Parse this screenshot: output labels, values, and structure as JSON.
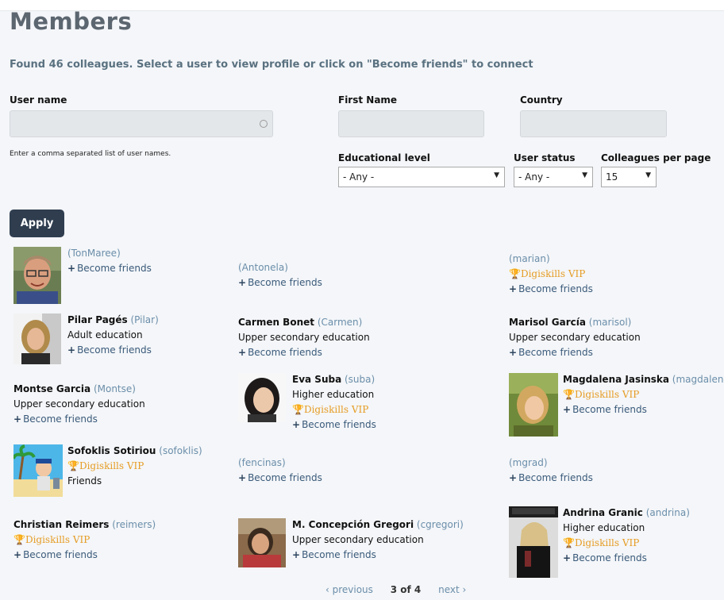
{
  "page": {
    "title": "Members",
    "found_text": "Found 46 colleagues. Select a user to view profile or click on \"Become friends\" to connect"
  },
  "filters": {
    "username_label": "User name",
    "username_hint": "Enter a comma separated list of user names.",
    "firstname_label": "First Name",
    "country_label": "Country",
    "edu_label": "Educational level",
    "edu_value": "- Any -",
    "status_label": "User status",
    "status_value": "- Any -",
    "perpage_label": "Colleagues per page",
    "perpage_value": "15",
    "apply_label": "Apply"
  },
  "labels": {
    "become_friends": "Become friends",
    "vip": "Digiskills VIP",
    "plus": "+",
    "trophy": "🏆"
  },
  "members": [
    {
      "name": "",
      "username": "(TonMaree)",
      "education": "",
      "vip": false,
      "status": "",
      "has_become": true,
      "avatar": "photo-man-glasses"
    },
    {
      "name": "",
      "username": "(Antonela)",
      "education": "",
      "vip": false,
      "status": "",
      "has_become": true,
      "avatar": ""
    },
    {
      "name": "",
      "username": "(marian)",
      "education": "",
      "vip": true,
      "status": "",
      "has_become": true,
      "avatar": ""
    },
    {
      "name": "Pilar Pagés",
      "username": "(Pilar)",
      "education": "Adult education",
      "vip": false,
      "status": "",
      "has_become": true,
      "avatar": "photo-woman-blonde"
    },
    {
      "name": "Carmen Bonet",
      "username": "(Carmen)",
      "education": "Upper secondary education",
      "vip": false,
      "status": "",
      "has_become": true,
      "avatar": ""
    },
    {
      "name": "Marisol García",
      "username": "(marisol)",
      "education": "Upper secondary education",
      "vip": false,
      "status": "",
      "has_become": true,
      "avatar": ""
    },
    {
      "name": "Montse Garcia",
      "username": "(Montse)",
      "education": "Upper secondary education",
      "vip": false,
      "status": "",
      "has_become": true,
      "avatar": ""
    },
    {
      "name": "Eva Suba",
      "username": "(suba)",
      "education": "Higher education",
      "vip": true,
      "status": "",
      "has_become": true,
      "avatar": "photo-woman-dark-hair"
    },
    {
      "name": "Magdalena Jasinska",
      "username": "(magdalena",
      "education": "",
      "vip": true,
      "status": "",
      "has_become": true,
      "avatar": "photo-woman-outdoor"
    },
    {
      "name": "Sofoklis Sotiriou",
      "username": "(sofoklis)",
      "education": "",
      "vip": true,
      "status": "Friends",
      "has_become": false,
      "avatar": "cartoon-beach"
    },
    {
      "name": "",
      "username": "(fencinas)",
      "education": "",
      "vip": false,
      "status": "",
      "has_become": true,
      "avatar": ""
    },
    {
      "name": "",
      "username": "(mgrad)",
      "education": "",
      "vip": false,
      "status": "",
      "has_become": true,
      "avatar": ""
    },
    {
      "name": "Christian Reimers",
      "username": "(reimers)",
      "education": "",
      "vip": true,
      "status": "",
      "has_become": true,
      "avatar": ""
    },
    {
      "name": "M. Concepción Gregori",
      "username": "(cgregori)",
      "education": "Upper secondary education",
      "vip": false,
      "status": "",
      "has_become": true,
      "avatar": "photo-woman-red-shirt"
    },
    {
      "name": "Andrina Granic",
      "username": "(andrina)",
      "education": "Higher education",
      "vip": true,
      "status": "",
      "has_become": true,
      "avatar": "photo-woman-black-coat"
    }
  ],
  "pager": {
    "prev": "‹ previous",
    "current": "3 of 4",
    "next": "next ›"
  }
}
